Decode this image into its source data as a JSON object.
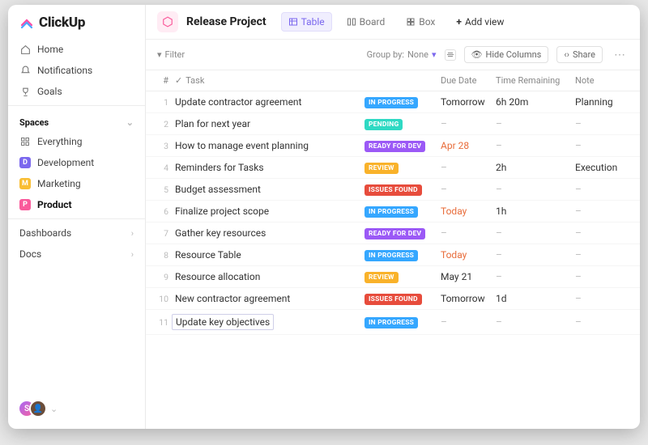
{
  "brand": "ClickUp",
  "nav": {
    "home": "Home",
    "notifications": "Notifications",
    "goals": "Goals",
    "spaces_label": "Spaces",
    "everything": "Everything",
    "development": "Development",
    "marketing": "Marketing",
    "product": "Product",
    "dashboards": "Dashboards",
    "docs": "Docs"
  },
  "header": {
    "project_title": "Release Project",
    "views": {
      "table": "Table",
      "board": "Board",
      "box": "Box",
      "add": "Add view"
    }
  },
  "toolbar": {
    "filter": "Filter",
    "group_by_label": "Group by:",
    "group_by_value": "None",
    "hide_columns": "Hide Columns",
    "share": "Share"
  },
  "columns": {
    "num": "#",
    "task": "Task",
    "due": "Due Date",
    "time": "Time Remaining",
    "note": "Note"
  },
  "status_labels": {
    "inprogress": "IN PROGRESS",
    "pending": "PENDING",
    "readyfordev": "READY FOR DEV",
    "review": "REVIEW",
    "issuesfound": "ISSUES FOUND"
  },
  "rows": [
    {
      "n": "1",
      "task": "Update contractor agreement",
      "status": "inprogress",
      "due": "Tomorrow",
      "time": "6h 20m",
      "note": "Planning"
    },
    {
      "n": "2",
      "task": "Plan for next year",
      "status": "pending",
      "due": "–",
      "time": "–",
      "note": "–"
    },
    {
      "n": "3",
      "task": "How to manage event planning",
      "status": "readyfordev",
      "due": "Apr 28",
      "due_red": true,
      "time": "–",
      "note": "–"
    },
    {
      "n": "4",
      "task": "Reminders for Tasks",
      "status": "review",
      "due": "–",
      "time": "2h",
      "note": "Execution"
    },
    {
      "n": "5",
      "task": "Budget assessment",
      "status": "issuesfound",
      "due": "–",
      "time": "–",
      "note": "–"
    },
    {
      "n": "6",
      "task": "Finalize project scope",
      "status": "inprogress",
      "due": "Today",
      "due_red": true,
      "time": "1h",
      "note": "–"
    },
    {
      "n": "7",
      "task": "Gather key resources",
      "status": "readyfordev",
      "due": "–",
      "time": "–",
      "note": "–"
    },
    {
      "n": "8",
      "task": "Resource Table",
      "status": "inprogress",
      "due": "Today",
      "due_red": true,
      "time": "–",
      "note": "–"
    },
    {
      "n": "9",
      "task": "Resource allocation",
      "status": "review",
      "due": "May 21",
      "time": "–",
      "note": "–"
    },
    {
      "n": "10",
      "task": "New contractor agreement",
      "status": "issuesfound",
      "due": "Tomorrow",
      "time": "1d",
      "note": "–"
    },
    {
      "n": "11",
      "task": "Update key objectives",
      "status": "inprogress",
      "due": "–",
      "time": "–",
      "note": "–",
      "editing": true
    }
  ],
  "avatars": {
    "a1": "S",
    "a2": ""
  }
}
